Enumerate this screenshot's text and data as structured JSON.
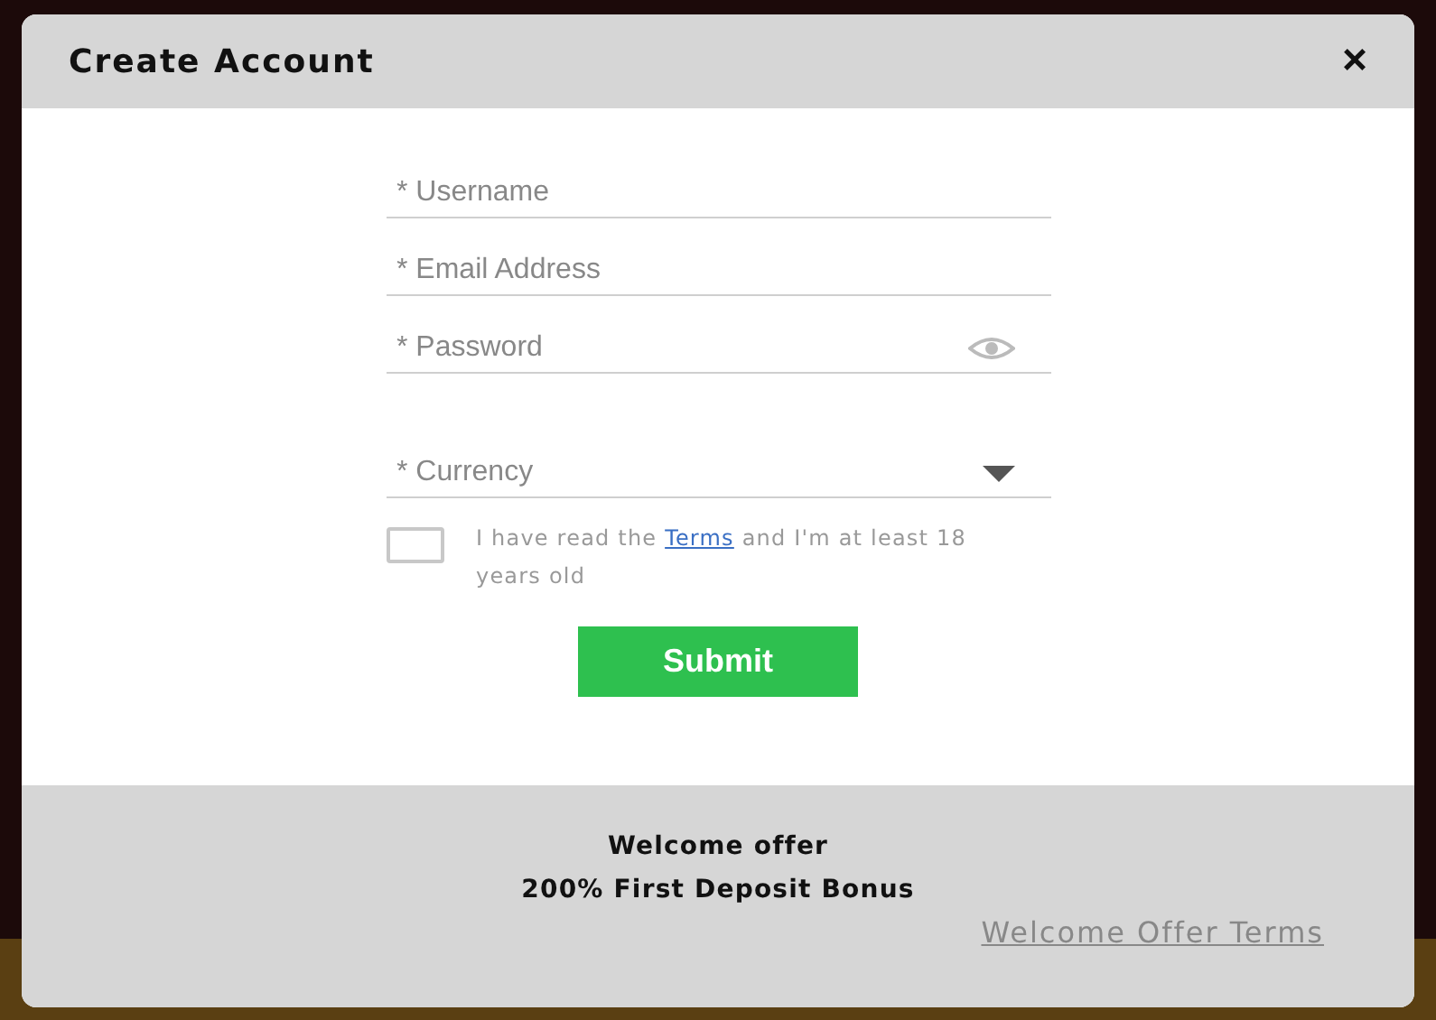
{
  "dialog": {
    "title": "Create Account",
    "close": "×"
  },
  "fields": [
    {
      "kind": "text",
      "placeholder": "* Username"
    },
    {
      "kind": "text",
      "placeholder": "* Email Address"
    },
    {
      "kind": "password",
      "placeholder": "* Password"
    },
    {
      "kind": "select",
      "placeholder": "* Currency"
    }
  ],
  "agreement": {
    "checked": false,
    "before": "I have read the ",
    "link": "Terms",
    "after": " and I'm at least 18 years old"
  },
  "submit": "Submit",
  "footer": {
    "heading": "Welcome offer",
    "bonus": "200% First Deposit Bonus",
    "terms_link": "Welcome Offer Terms"
  }
}
